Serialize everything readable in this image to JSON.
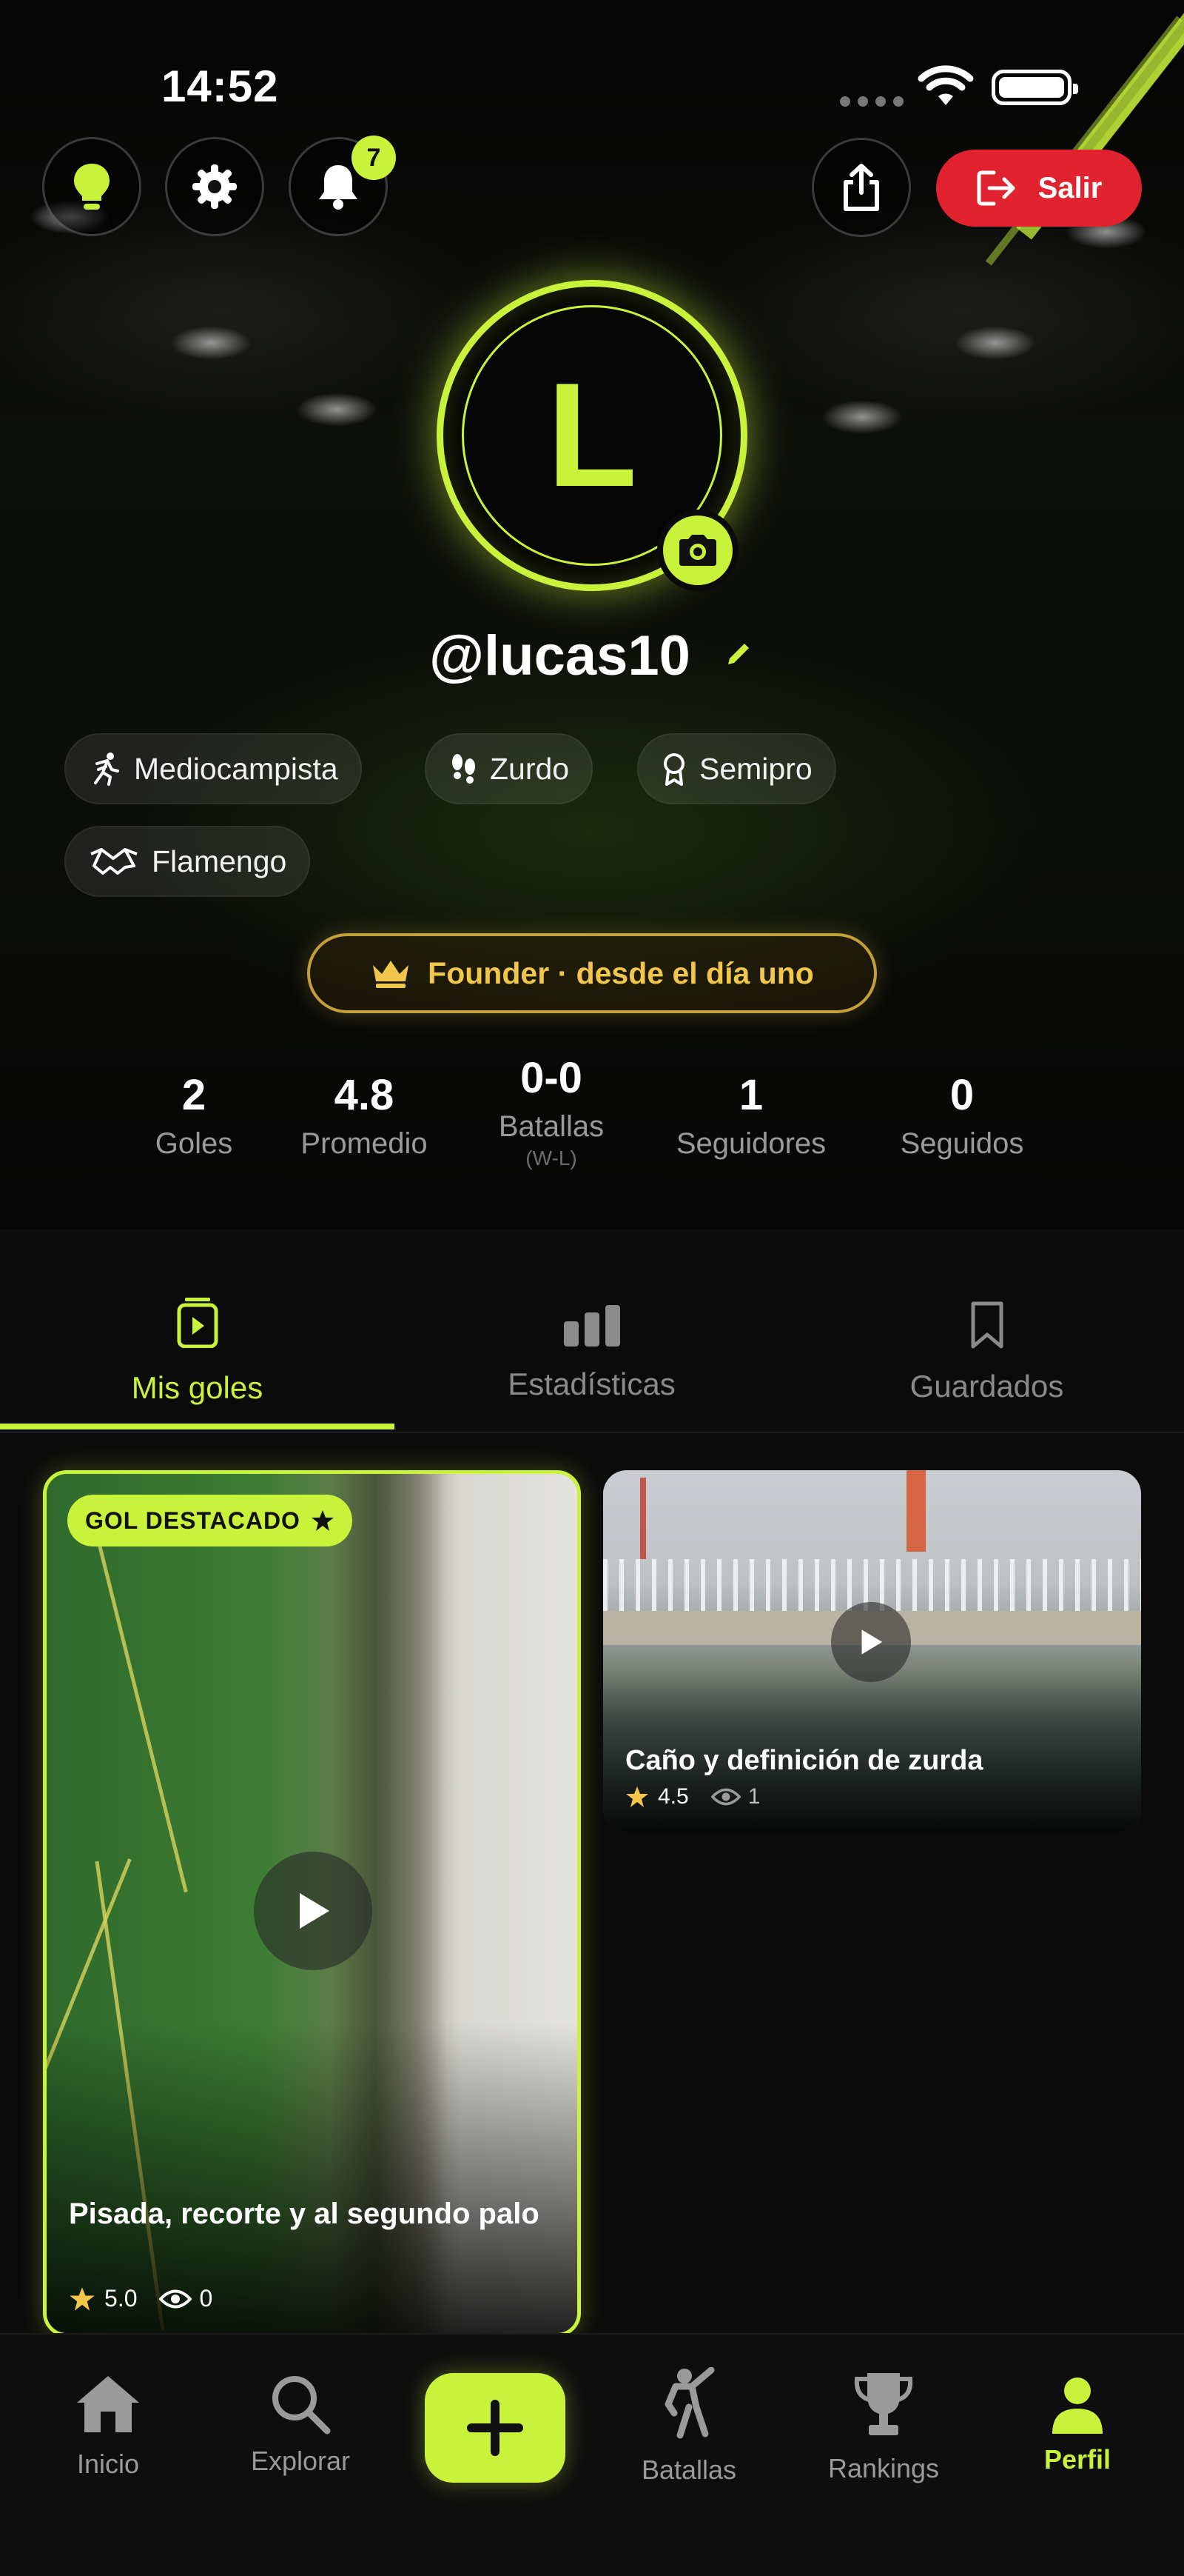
{
  "status": {
    "time": "14:52"
  },
  "header": {
    "notifications_count": "7",
    "logout_label": "Salir"
  },
  "profile": {
    "avatar_letter": "L",
    "username": "@lucas10",
    "chips": [
      "Mediocampista",
      "Zurdo",
      "Semipro",
      "Flamengo"
    ],
    "founder_label": "Founder · desde el día uno",
    "stats": [
      {
        "value": "2",
        "label": "Goles"
      },
      {
        "value": "4.8",
        "label": "Promedio"
      },
      {
        "value": "0-0",
        "label": "Batallas",
        "sublabel": "(W-L)"
      },
      {
        "value": "1",
        "label": "Seguidores"
      },
      {
        "value": "0",
        "label": "Seguidos"
      }
    ]
  },
  "tabs": [
    {
      "label": "Mis goles",
      "icon": "play-square-icon",
      "active": true
    },
    {
      "label": "Estadísticas",
      "icon": "bar-chart-icon",
      "active": false
    },
    {
      "label": "Guardados",
      "icon": "bookmark-icon",
      "active": false
    }
  ],
  "videos": [
    {
      "tag": "GOL DESTACADO",
      "title": "Pisada, recorte y al segundo palo",
      "rating": "5.0",
      "views": "0"
    },
    {
      "title": "Caño y definición de zurda",
      "rating": "4.5",
      "views": "1"
    }
  ],
  "nav": [
    {
      "label": "Inicio",
      "icon": "home-icon"
    },
    {
      "label": "Explorar",
      "icon": "search-icon"
    },
    {
      "label": "Batallas",
      "icon": "fencing-icon"
    },
    {
      "label": "Rankings",
      "icon": "trophy-icon"
    },
    {
      "label": "Perfil",
      "icon": "person-icon",
      "active": true
    }
  ],
  "colors": {
    "accent": "#c9f23b",
    "danger": "#e0232f",
    "gold": "#f2c64a",
    "background": "#0b0b0b"
  }
}
